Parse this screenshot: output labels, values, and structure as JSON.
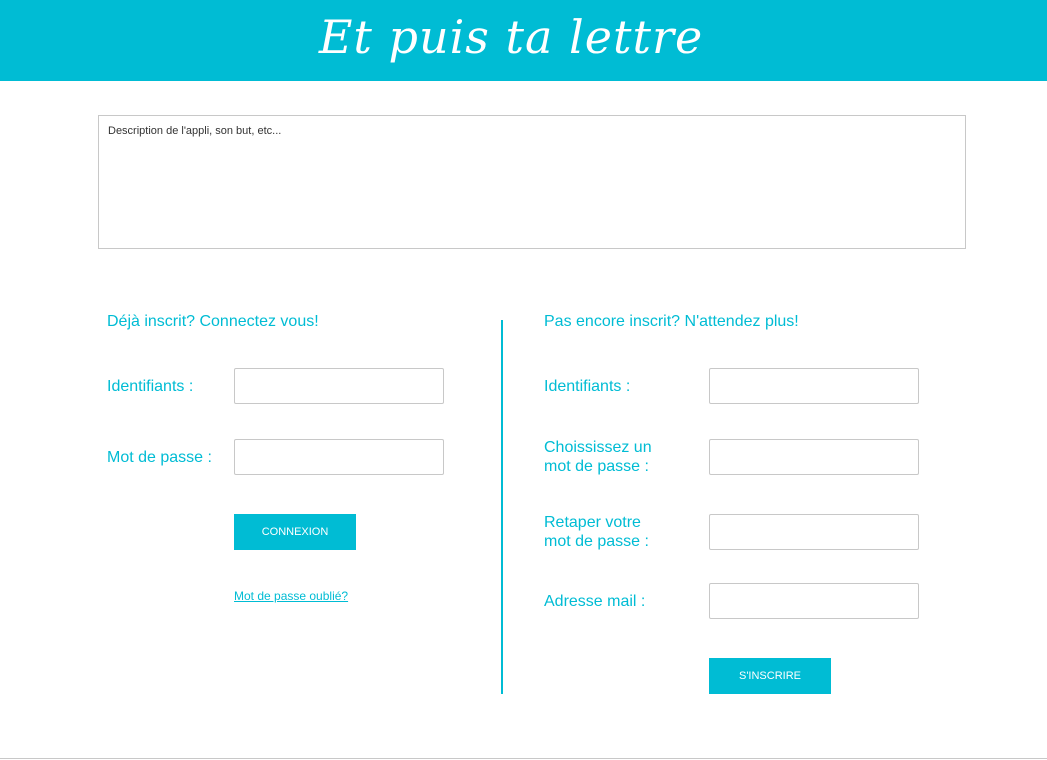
{
  "header": {
    "title": "Et puis ta lettre"
  },
  "description": {
    "text": "Description de l'appli, son but, etc..."
  },
  "login": {
    "heading": "Déjà inscrit? Connectez vous!",
    "username_label": "Identifiants :",
    "username_value": "",
    "password_label": "Mot de passe :",
    "password_value": "",
    "submit_label": "Connexion",
    "forgot_link": "Mot de passe oublié?"
  },
  "signup": {
    "heading": "Pas encore inscrit? N'attendez plus!",
    "username_label": "Identifiants :",
    "username_value": "",
    "password_label_line1": "Choississez un",
    "password_label_line2": "mot de passe :",
    "password_value": "",
    "confirm_label_line1": "Retaper votre",
    "confirm_label_line2": "mot de passe :",
    "confirm_value": "",
    "email_label": "Adresse mail :",
    "email_value": "",
    "submit_label": "S'inscrire"
  },
  "colors": {
    "accent": "#00bcd4",
    "border": "#c8c8c8",
    "background": "#ffffff"
  }
}
